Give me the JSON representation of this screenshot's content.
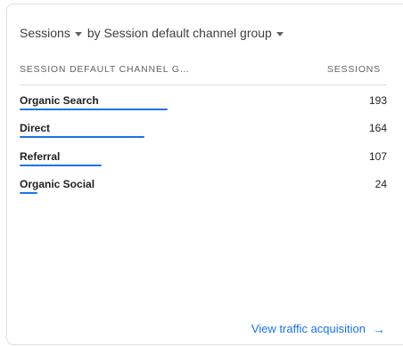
{
  "card": {
    "metric_label": "Sessions",
    "dimension_label": "by Session default channel group",
    "columns": {
      "dimension": "SESSION DEFAULT CHANNEL G…",
      "metric": "SESSIONS"
    },
    "rows": [
      {
        "label": "Organic Search",
        "value": "193",
        "bar_fraction": 0.83
      },
      {
        "label": "Direct",
        "value": "164",
        "bar_fraction": 0.7
      },
      {
        "label": "Referral",
        "value": "107",
        "bar_fraction": 0.46
      },
      {
        "label": "Organic Social",
        "value": "24",
        "bar_fraction": 0.1
      }
    ],
    "footer_link": "View traffic acquisition",
    "accent_color": "#1a73e8",
    "icons": {
      "metric_dropdown": "caret-down-icon",
      "dimension_dropdown": "caret-down-icon",
      "footer_arrow": "arrow-right-icon"
    }
  }
}
